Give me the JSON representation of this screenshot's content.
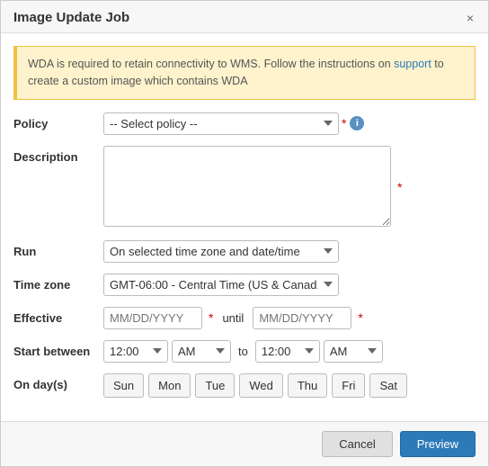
{
  "dialog": {
    "title": "Image Update Job",
    "close_label": "×"
  },
  "alert": {
    "text_before": "WDA is required to retain connectivity to WMS. Follow the instructions on ",
    "link_text": "support",
    "text_after": " to create a custom image which contains WDA"
  },
  "form": {
    "policy_label": "Policy",
    "policy_placeholder": "-- Select policy --",
    "description_label": "Description",
    "description_placeholder": "",
    "run_label": "Run",
    "run_value": "On selected time zone and date/time",
    "timezone_label": "Time zone",
    "timezone_value": "GMT-06:00 - Central Time (US & Canad...",
    "effective_label": "Effective",
    "effective_placeholder": "MM/DD/YYYY",
    "until_label": "until",
    "until_placeholder": "MM/DD/YYYY",
    "start_between_label": "Start between",
    "time_start": "12:00",
    "ampm_start": "AM",
    "to_label": "to",
    "time_end": "12:00",
    "ampm_end": "AM",
    "on_days_label": "On day(s)",
    "days": [
      "Sun",
      "Mon",
      "Tue",
      "Wed",
      "Thu",
      "Fri",
      "Sat"
    ],
    "required_star": "*",
    "cancel_label": "Cancel",
    "preview_label": "Preview"
  }
}
